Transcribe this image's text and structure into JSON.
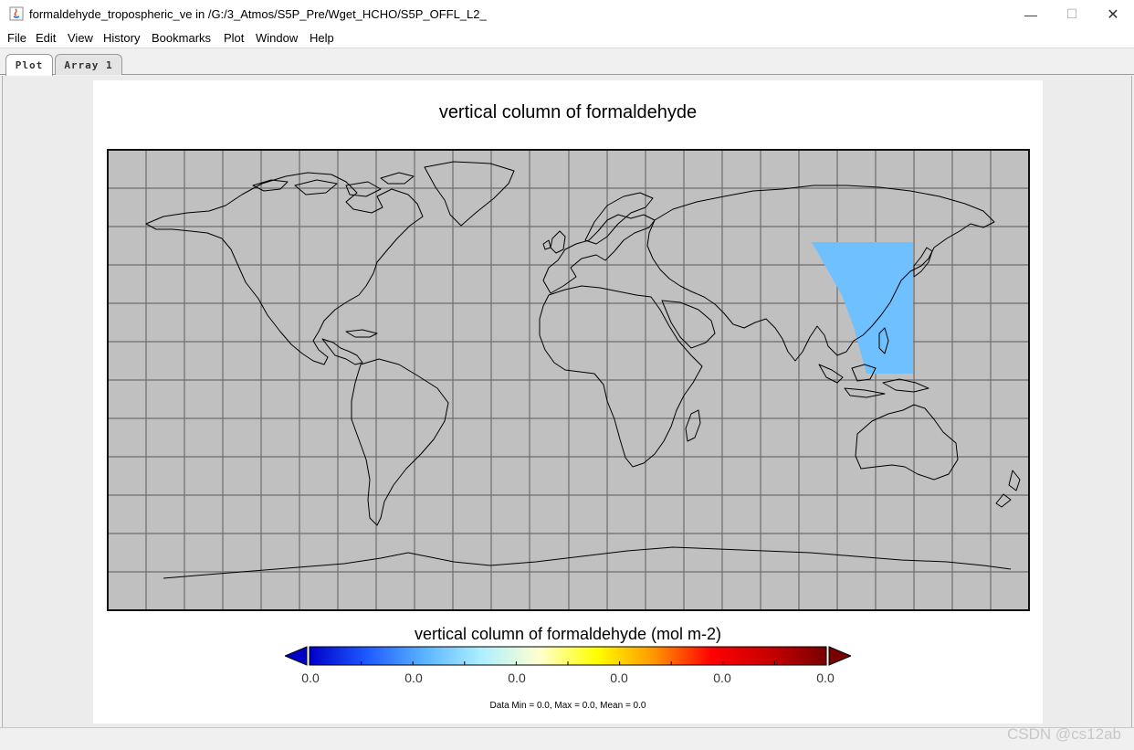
{
  "window": {
    "title": "formaldehyde_tropospheric_ve in /G:/3_Atmos/S5P_Pre/Wget_HCHO/S5P_OFFL_L2_",
    "controls": {
      "minimize": "—",
      "maximize": "☐",
      "close": "✕"
    }
  },
  "menu": {
    "items": [
      "File",
      "Edit",
      "View",
      "History",
      "Bookmarks",
      "Plot",
      "Window",
      "Help"
    ]
  },
  "tabs": [
    "Plot",
    "Array 1"
  ],
  "plot": {
    "title": "vertical column of formaldehyde",
    "map_background": "#c0c0c0",
    "data_fill": "#6ec0ff",
    "colorbar": {
      "title": "vertical column of formaldehyde (mol m-2)",
      "tick_labels": [
        "0.0",
        "0.0",
        "0.0",
        "0.0",
        "0.0",
        "0.0"
      ],
      "colors": [
        "#0000c8",
        "#1e5aff",
        "#5ab4ff",
        "#aef0ff",
        "#ffffd0",
        "#ffff00",
        "#ff9600",
        "#ff0000",
        "#c80000",
        "#780000"
      ]
    },
    "stats": "Data Min = 0.0, Max = 0.0, Mean = 0.0"
  },
  "watermark": "CSDN @cs12ab"
}
